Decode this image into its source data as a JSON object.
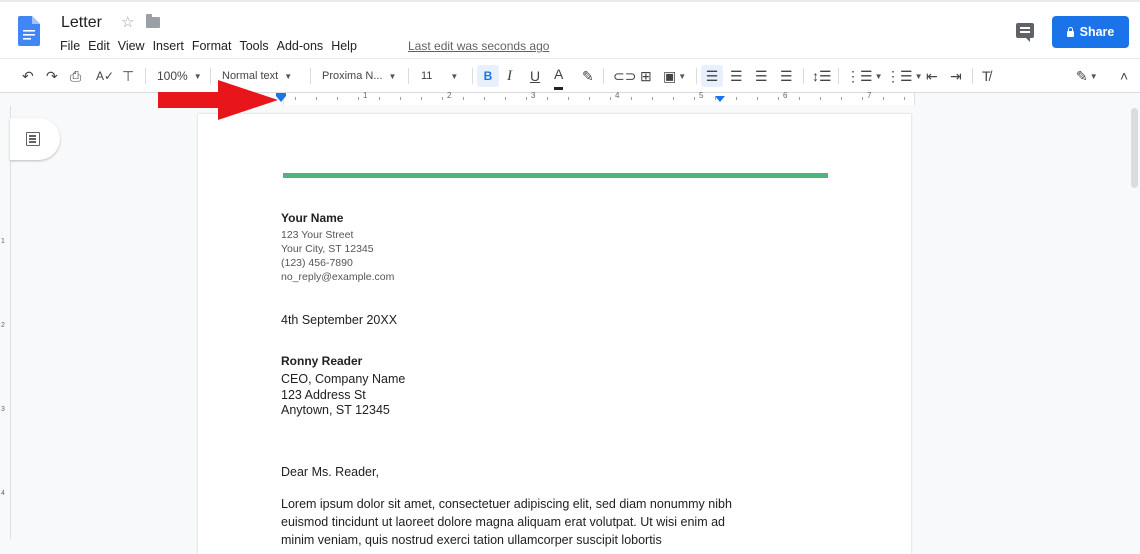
{
  "app": {
    "doc_title": "Letter",
    "menus": [
      "File",
      "Edit",
      "View",
      "Insert",
      "Format",
      "Tools",
      "Add-ons",
      "Help"
    ],
    "last_edit": "Last edit was seconds ago",
    "share_label": "Share"
  },
  "toolbar": {
    "zoom": "100%",
    "style": "Normal text",
    "font": "Proxima N...",
    "font_size": "11"
  },
  "ruler": {
    "numbers": [
      "1",
      "2",
      "3",
      "4",
      "5",
      "6",
      "7"
    ]
  },
  "vruler": {
    "numbers": [
      "1",
      "2",
      "3",
      "4"
    ]
  },
  "document": {
    "sender_name": "Your Name",
    "sender_address": [
      "123 Your Street",
      "Your City, ST 12345",
      "(123) 456-7890",
      "no_reply@example.com"
    ],
    "date": "4th September 20XX",
    "recipient_name": "Ronny Reader",
    "recipient_address": [
      "CEO, Company Name",
      "123 Address St",
      "Anytown, ST 12345"
    ],
    "greeting": "Dear Ms. Reader,",
    "body": "Lorem ipsum dolor sit amet, consectetuer adipiscing elit, sed diam nonummy nibh euismod tincidunt ut laoreet dolore magna aliquam erat volutpat. Ut wisi enim ad minim veniam, quis nostrud exerci tation ullamcorper suscipit lobortis"
  },
  "colors": {
    "accent": "#1a73e8",
    "rule_green": "#4fb37e",
    "arrow_red": "#e8161b"
  }
}
